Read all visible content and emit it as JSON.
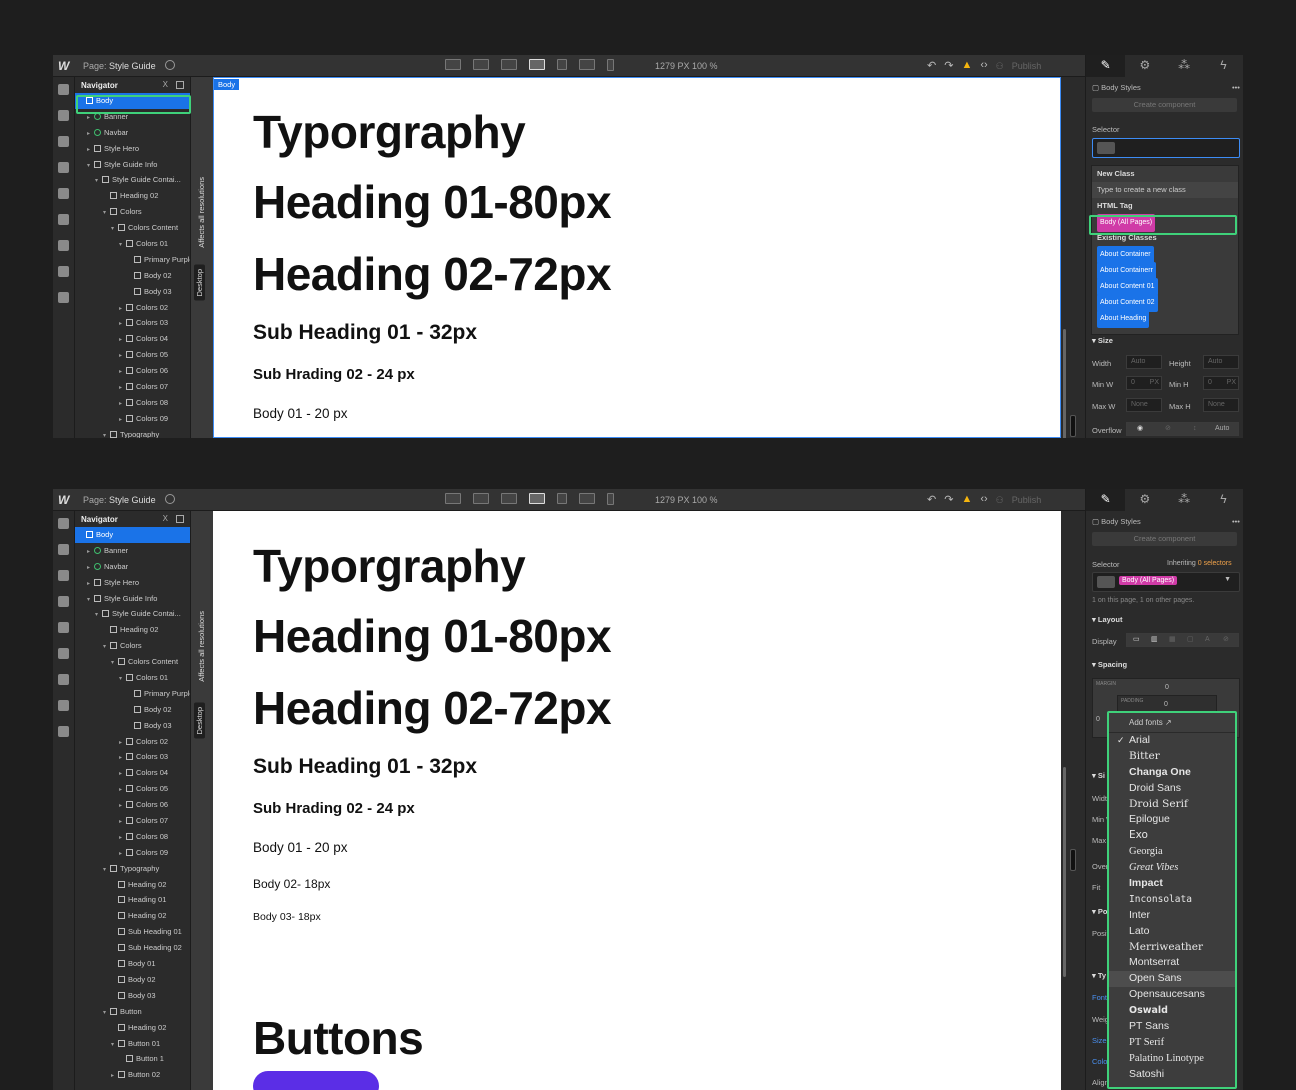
{
  "app": {
    "logo": "W",
    "page_label": "Page:",
    "page_name": "Style Guide",
    "zoom": "1279 PX  100 %",
    "publish": "Publish",
    "rail_icons": [
      "add-icon",
      "box-icon",
      "menu-icon",
      "page-icon",
      "database-icon",
      "users-icon",
      "cart-icon",
      "assets-icon",
      "gear-icon"
    ],
    "panel_tabs": [
      "brush-icon",
      "gear-icon",
      "drops-icon",
      "bolt-icon"
    ]
  },
  "navigator": {
    "title": "Navigator",
    "close": "X"
  },
  "nav_tree_1": [
    {
      "label": "Body",
      "indent": 0,
      "caret": "",
      "kind": "box",
      "sel": true
    },
    {
      "label": "Banner",
      "indent": 1,
      "caret": "▸",
      "kind": "comp"
    },
    {
      "label": "Navbar",
      "indent": 1,
      "caret": "▸",
      "kind": "comp"
    },
    {
      "label": "Style Hero",
      "indent": 1,
      "caret": "▸",
      "kind": "box"
    },
    {
      "label": "Style Guide Info",
      "indent": 1,
      "caret": "▾",
      "kind": "box"
    },
    {
      "label": "Style Guide Contai...",
      "indent": 2,
      "caret": "▾",
      "kind": "box"
    },
    {
      "label": "Heading 02",
      "indent": 3,
      "caret": "",
      "kind": "txt"
    },
    {
      "label": "Colors",
      "indent": 3,
      "caret": "▾",
      "kind": "box"
    },
    {
      "label": "Colors Content",
      "indent": 4,
      "caret": "▾",
      "kind": "box"
    },
    {
      "label": "Colors 01",
      "indent": 5,
      "caret": "▾",
      "kind": "box"
    },
    {
      "label": "Primary Purple",
      "indent": 6,
      "caret": "",
      "kind": "box"
    },
    {
      "label": "Body 02",
      "indent": 6,
      "caret": "",
      "kind": "txt"
    },
    {
      "label": "Body 03",
      "indent": 6,
      "caret": "",
      "kind": "txt"
    },
    {
      "label": "Colors 02",
      "indent": 5,
      "caret": "▸",
      "kind": "box"
    },
    {
      "label": "Colors 03",
      "indent": 5,
      "caret": "▸",
      "kind": "box"
    },
    {
      "label": "Colors 04",
      "indent": 5,
      "caret": "▸",
      "kind": "box"
    },
    {
      "label": "Colors 05",
      "indent": 5,
      "caret": "▸",
      "kind": "box"
    },
    {
      "label": "Colors 06",
      "indent": 5,
      "caret": "▸",
      "kind": "box"
    },
    {
      "label": "Colors 07",
      "indent": 5,
      "caret": "▸",
      "kind": "box"
    },
    {
      "label": "Colors 08",
      "indent": 5,
      "caret": "▸",
      "kind": "box"
    },
    {
      "label": "Colors 09",
      "indent": 5,
      "caret": "▸",
      "kind": "box"
    },
    {
      "label": "Typography",
      "indent": 3,
      "caret": "▾",
      "kind": "box"
    }
  ],
  "nav_tree_2": [
    {
      "label": "Body",
      "indent": 0,
      "caret": "",
      "kind": "box",
      "sel": true
    },
    {
      "label": "Banner",
      "indent": 1,
      "caret": "▸",
      "kind": "comp"
    },
    {
      "label": "Navbar",
      "indent": 1,
      "caret": "▸",
      "kind": "comp"
    },
    {
      "label": "Style Hero",
      "indent": 1,
      "caret": "▸",
      "kind": "box"
    },
    {
      "label": "Style Guide Info",
      "indent": 1,
      "caret": "▾",
      "kind": "box"
    },
    {
      "label": "Style Guide Contai...",
      "indent": 2,
      "caret": "▾",
      "kind": "box"
    },
    {
      "label": "Heading 02",
      "indent": 3,
      "caret": "",
      "kind": "txt"
    },
    {
      "label": "Colors",
      "indent": 3,
      "caret": "▾",
      "kind": "box"
    },
    {
      "label": "Colors Content",
      "indent": 4,
      "caret": "▾",
      "kind": "box"
    },
    {
      "label": "Colors 01",
      "indent": 5,
      "caret": "▾",
      "kind": "box"
    },
    {
      "label": "Primary Purple",
      "indent": 6,
      "caret": "",
      "kind": "box"
    },
    {
      "label": "Body 02",
      "indent": 6,
      "caret": "",
      "kind": "txt"
    },
    {
      "label": "Body 03",
      "indent": 6,
      "caret": "",
      "kind": "txt"
    },
    {
      "label": "Colors 02",
      "indent": 5,
      "caret": "▸",
      "kind": "box"
    },
    {
      "label": "Colors 03",
      "indent": 5,
      "caret": "▸",
      "kind": "box"
    },
    {
      "label": "Colors 04",
      "indent": 5,
      "caret": "▸",
      "kind": "box"
    },
    {
      "label": "Colors 05",
      "indent": 5,
      "caret": "▸",
      "kind": "box"
    },
    {
      "label": "Colors 06",
      "indent": 5,
      "caret": "▸",
      "kind": "box"
    },
    {
      "label": "Colors 07",
      "indent": 5,
      "caret": "▸",
      "kind": "box"
    },
    {
      "label": "Colors 08",
      "indent": 5,
      "caret": "▸",
      "kind": "box"
    },
    {
      "label": "Colors 09",
      "indent": 5,
      "caret": "▸",
      "kind": "box"
    },
    {
      "label": "Typography",
      "indent": 3,
      "caret": "▾",
      "kind": "box"
    },
    {
      "label": "Heading 02",
      "indent": 4,
      "caret": "",
      "kind": "txt"
    },
    {
      "label": "Heading 01",
      "indent": 4,
      "caret": "",
      "kind": "txt"
    },
    {
      "label": "Heading 02",
      "indent": 4,
      "caret": "",
      "kind": "txt"
    },
    {
      "label": "Sub Heading 01",
      "indent": 4,
      "caret": "",
      "kind": "txt"
    },
    {
      "label": "Sub Heading 02",
      "indent": 4,
      "caret": "",
      "kind": "txt"
    },
    {
      "label": "Body 01",
      "indent": 4,
      "caret": "",
      "kind": "txt"
    },
    {
      "label": "Body 02",
      "indent": 4,
      "caret": "",
      "kind": "txt"
    },
    {
      "label": "Body 03",
      "indent": 4,
      "caret": "",
      "kind": "txt"
    },
    {
      "label": "Button",
      "indent": 3,
      "caret": "▾",
      "kind": "box"
    },
    {
      "label": "Heading 02",
      "indent": 4,
      "caret": "",
      "kind": "txt"
    },
    {
      "label": "Button 01",
      "indent": 4,
      "caret": "▾",
      "kind": "box"
    },
    {
      "label": "Button 1",
      "indent": 5,
      "caret": "",
      "kind": "txt"
    },
    {
      "label": "Button 02",
      "indent": 4,
      "caret": "▸",
      "kind": "box"
    }
  ],
  "canvas": {
    "body_label": "Body",
    "affects": "Affects all resolutions",
    "desktop": "Desktop",
    "title": "Typorgraphy",
    "h1": "Heading 01-80px",
    "h2": "Heading 02-72px",
    "sub1": "Sub Heading 01 - 32px",
    "sub2": "Sub Hrading 02 - 24 px",
    "body1": "Body 01 - 20 px",
    "body2": "Body 02- 18px",
    "body3": "Body 03- 18px",
    "buttons": "Buttons"
  },
  "panel1": {
    "body_styles": "Body Styles",
    "create_component": "Create component",
    "selector": "Selector",
    "new_class": "New Class",
    "type_to_create": "Type to create a new class",
    "html_tag": "HTML Tag",
    "body_all_pages": "Body (All Pages)",
    "existing_classes": "Existing Classes",
    "classes": [
      "About Container",
      "About Containerr",
      "About Content 01",
      "About Content 02",
      "About Heading"
    ],
    "size": "Size",
    "width": "Width",
    "height": "Height",
    "auto": "Auto",
    "min_w": "Min W",
    "min_h": "Min H",
    "zero": "0",
    "px": "PX",
    "max_w": "Max W",
    "max_h": "Max H",
    "none": "None",
    "overflow": "Overflow",
    "overflow_auto": "Auto"
  },
  "panel2": {
    "body_styles": "Body Styles",
    "create_component": "Create component",
    "selector": "Selector",
    "inheriting": "Inheriting",
    "selectors": "0 selectors",
    "body_all_pages": "Body (All Pages)",
    "on_page": "1 on this page, 1 on other pages.",
    "layout": "Layout",
    "display": "Display",
    "spacing": "Spacing",
    "margin": "MARGIN",
    "padding": "PADDING",
    "zero": "0",
    "partial_labels": [
      "Si",
      "Width",
      "Min W",
      "Max W",
      "Overf",
      "Fit",
      "Po",
      "Positi",
      "Ty",
      "Font",
      "Weigh",
      "Size",
      "Color",
      "Align"
    ]
  },
  "fonts": {
    "add_fonts": "Add fonts",
    "selected": "Arial",
    "hovered": "Open Sans",
    "items": [
      "Arial",
      "Bitter",
      "Changa One",
      "Droid Sans",
      "Droid Serif",
      "Epilogue",
      "Exo",
      "Georgia",
      "Great Vibes",
      "Impact",
      "Inconsolata",
      "Inter",
      "Lato",
      "Merriweather",
      "Montserrat",
      "Open Sans",
      "Opensaucesans",
      "Oswald",
      "PT Sans",
      "PT Serif",
      "Palatino Linotype",
      "Satoshi"
    ]
  },
  "colors": {
    "accent": "#1a73e8",
    "highlight": "#3fd17a",
    "pink": "#d03ba7",
    "button_purple": "#5b2ee6",
    "warning": "#f5b50e"
  }
}
